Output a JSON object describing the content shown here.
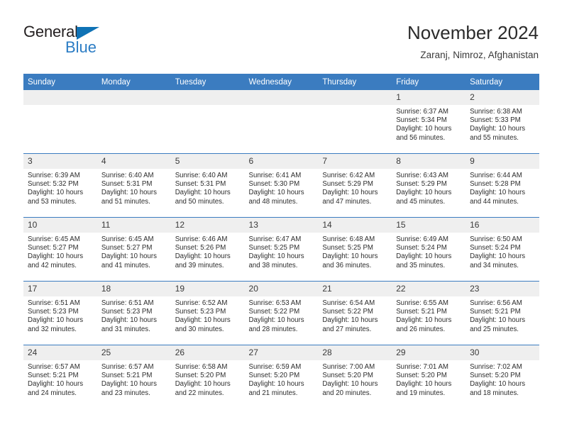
{
  "brand": {
    "word1": "General",
    "word2": "Blue",
    "triangle_color": "#0f72b5",
    "blue_text_color": "#2b7cc4"
  },
  "header": {
    "title": "November 2024",
    "location": "Zaranj, Nimroz, Afghanistan"
  },
  "theme": {
    "header_blue": "#3b7cc0",
    "daynum_band": "#efefef",
    "cell_bg": "#ffffff",
    "text": "#2d2d2d"
  },
  "weekdays": [
    "Sunday",
    "Monday",
    "Tuesday",
    "Wednesday",
    "Thursday",
    "Friday",
    "Saturday"
  ],
  "labels": {
    "sunrise": "Sunrise:",
    "sunset": "Sunset:",
    "daylight": "Daylight:"
  },
  "weeks": [
    [
      {
        "day": "",
        "sunrise": "",
        "sunset": "",
        "daylight1": "",
        "daylight2": ""
      },
      {
        "day": "",
        "sunrise": "",
        "sunset": "",
        "daylight1": "",
        "daylight2": ""
      },
      {
        "day": "",
        "sunrise": "",
        "sunset": "",
        "daylight1": "",
        "daylight2": ""
      },
      {
        "day": "",
        "sunrise": "",
        "sunset": "",
        "daylight1": "",
        "daylight2": ""
      },
      {
        "day": "",
        "sunrise": "",
        "sunset": "",
        "daylight1": "",
        "daylight2": ""
      },
      {
        "day": "1",
        "sunrise": "Sunrise: 6:37 AM",
        "sunset": "Sunset: 5:34 PM",
        "daylight1": "Daylight: 10 hours",
        "daylight2": "and 56 minutes."
      },
      {
        "day": "2",
        "sunrise": "Sunrise: 6:38 AM",
        "sunset": "Sunset: 5:33 PM",
        "daylight1": "Daylight: 10 hours",
        "daylight2": "and 55 minutes."
      }
    ],
    [
      {
        "day": "3",
        "sunrise": "Sunrise: 6:39 AM",
        "sunset": "Sunset: 5:32 PM",
        "daylight1": "Daylight: 10 hours",
        "daylight2": "and 53 minutes."
      },
      {
        "day": "4",
        "sunrise": "Sunrise: 6:40 AM",
        "sunset": "Sunset: 5:31 PM",
        "daylight1": "Daylight: 10 hours",
        "daylight2": "and 51 minutes."
      },
      {
        "day": "5",
        "sunrise": "Sunrise: 6:40 AM",
        "sunset": "Sunset: 5:31 PM",
        "daylight1": "Daylight: 10 hours",
        "daylight2": "and 50 minutes."
      },
      {
        "day": "6",
        "sunrise": "Sunrise: 6:41 AM",
        "sunset": "Sunset: 5:30 PM",
        "daylight1": "Daylight: 10 hours",
        "daylight2": "and 48 minutes."
      },
      {
        "day": "7",
        "sunrise": "Sunrise: 6:42 AM",
        "sunset": "Sunset: 5:29 PM",
        "daylight1": "Daylight: 10 hours",
        "daylight2": "and 47 minutes."
      },
      {
        "day": "8",
        "sunrise": "Sunrise: 6:43 AM",
        "sunset": "Sunset: 5:29 PM",
        "daylight1": "Daylight: 10 hours",
        "daylight2": "and 45 minutes."
      },
      {
        "day": "9",
        "sunrise": "Sunrise: 6:44 AM",
        "sunset": "Sunset: 5:28 PM",
        "daylight1": "Daylight: 10 hours",
        "daylight2": "and 44 minutes."
      }
    ],
    [
      {
        "day": "10",
        "sunrise": "Sunrise: 6:45 AM",
        "sunset": "Sunset: 5:27 PM",
        "daylight1": "Daylight: 10 hours",
        "daylight2": "and 42 minutes."
      },
      {
        "day": "11",
        "sunrise": "Sunrise: 6:45 AM",
        "sunset": "Sunset: 5:27 PM",
        "daylight1": "Daylight: 10 hours",
        "daylight2": "and 41 minutes."
      },
      {
        "day": "12",
        "sunrise": "Sunrise: 6:46 AM",
        "sunset": "Sunset: 5:26 PM",
        "daylight1": "Daylight: 10 hours",
        "daylight2": "and 39 minutes."
      },
      {
        "day": "13",
        "sunrise": "Sunrise: 6:47 AM",
        "sunset": "Sunset: 5:25 PM",
        "daylight1": "Daylight: 10 hours",
        "daylight2": "and 38 minutes."
      },
      {
        "day": "14",
        "sunrise": "Sunrise: 6:48 AM",
        "sunset": "Sunset: 5:25 PM",
        "daylight1": "Daylight: 10 hours",
        "daylight2": "and 36 minutes."
      },
      {
        "day": "15",
        "sunrise": "Sunrise: 6:49 AM",
        "sunset": "Sunset: 5:24 PM",
        "daylight1": "Daylight: 10 hours",
        "daylight2": "and 35 minutes."
      },
      {
        "day": "16",
        "sunrise": "Sunrise: 6:50 AM",
        "sunset": "Sunset: 5:24 PM",
        "daylight1": "Daylight: 10 hours",
        "daylight2": "and 34 minutes."
      }
    ],
    [
      {
        "day": "17",
        "sunrise": "Sunrise: 6:51 AM",
        "sunset": "Sunset: 5:23 PM",
        "daylight1": "Daylight: 10 hours",
        "daylight2": "and 32 minutes."
      },
      {
        "day": "18",
        "sunrise": "Sunrise: 6:51 AM",
        "sunset": "Sunset: 5:23 PM",
        "daylight1": "Daylight: 10 hours",
        "daylight2": "and 31 minutes."
      },
      {
        "day": "19",
        "sunrise": "Sunrise: 6:52 AM",
        "sunset": "Sunset: 5:23 PM",
        "daylight1": "Daylight: 10 hours",
        "daylight2": "and 30 minutes."
      },
      {
        "day": "20",
        "sunrise": "Sunrise: 6:53 AM",
        "sunset": "Sunset: 5:22 PM",
        "daylight1": "Daylight: 10 hours",
        "daylight2": "and 28 minutes."
      },
      {
        "day": "21",
        "sunrise": "Sunrise: 6:54 AM",
        "sunset": "Sunset: 5:22 PM",
        "daylight1": "Daylight: 10 hours",
        "daylight2": "and 27 minutes."
      },
      {
        "day": "22",
        "sunrise": "Sunrise: 6:55 AM",
        "sunset": "Sunset: 5:21 PM",
        "daylight1": "Daylight: 10 hours",
        "daylight2": "and 26 minutes."
      },
      {
        "day": "23",
        "sunrise": "Sunrise: 6:56 AM",
        "sunset": "Sunset: 5:21 PM",
        "daylight1": "Daylight: 10 hours",
        "daylight2": "and 25 minutes."
      }
    ],
    [
      {
        "day": "24",
        "sunrise": "Sunrise: 6:57 AM",
        "sunset": "Sunset: 5:21 PM",
        "daylight1": "Daylight: 10 hours",
        "daylight2": "and 24 minutes."
      },
      {
        "day": "25",
        "sunrise": "Sunrise: 6:57 AM",
        "sunset": "Sunset: 5:21 PM",
        "daylight1": "Daylight: 10 hours",
        "daylight2": "and 23 minutes."
      },
      {
        "day": "26",
        "sunrise": "Sunrise: 6:58 AM",
        "sunset": "Sunset: 5:20 PM",
        "daylight1": "Daylight: 10 hours",
        "daylight2": "and 22 minutes."
      },
      {
        "day": "27",
        "sunrise": "Sunrise: 6:59 AM",
        "sunset": "Sunset: 5:20 PM",
        "daylight1": "Daylight: 10 hours",
        "daylight2": "and 21 minutes."
      },
      {
        "day": "28",
        "sunrise": "Sunrise: 7:00 AM",
        "sunset": "Sunset: 5:20 PM",
        "daylight1": "Daylight: 10 hours",
        "daylight2": "and 20 minutes."
      },
      {
        "day": "29",
        "sunrise": "Sunrise: 7:01 AM",
        "sunset": "Sunset: 5:20 PM",
        "daylight1": "Daylight: 10 hours",
        "daylight2": "and 19 minutes."
      },
      {
        "day": "30",
        "sunrise": "Sunrise: 7:02 AM",
        "sunset": "Sunset: 5:20 PM",
        "daylight1": "Daylight: 10 hours",
        "daylight2": "and 18 minutes."
      }
    ]
  ]
}
